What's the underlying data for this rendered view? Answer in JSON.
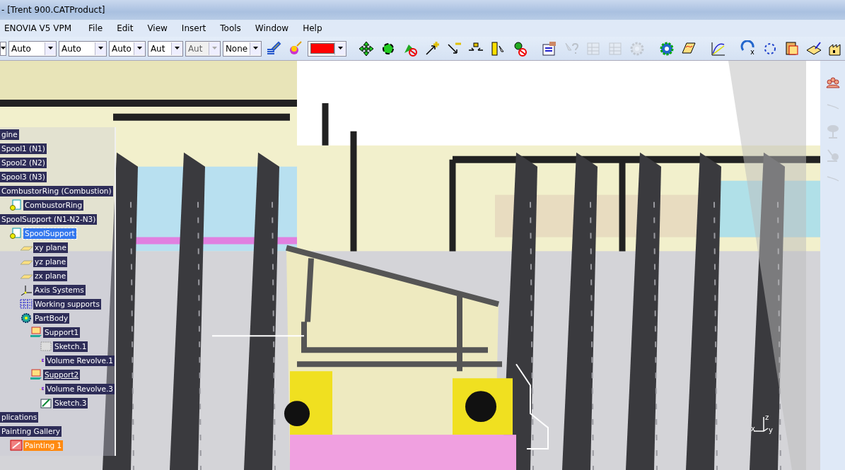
{
  "window": {
    "title": "- [Trent 900.CATProduct]"
  },
  "menu": [
    "ENOVIA V5 VPM",
    "File",
    "Edit",
    "View",
    "Insert",
    "Tools",
    "Window",
    "Help"
  ],
  "combos": [
    {
      "value": "Auto",
      "disabled": false
    },
    {
      "value": "Auto",
      "disabled": false
    },
    {
      "value": "Auto",
      "disabled": false
    },
    {
      "value": "Aut",
      "disabled": false
    },
    {
      "value": "Aut",
      "disabled": true
    },
    {
      "value": "None",
      "disabled": false
    }
  ],
  "color_combo": {
    "color": "#ff0000"
  },
  "tool_buttons": [
    {
      "kind": "brush",
      "disabled": false
    },
    {
      "kind": "ball",
      "disabled": false
    },
    {
      "kind": "move",
      "disabled": false
    },
    {
      "kind": "rotate",
      "disabled": false
    },
    {
      "kind": "nomove",
      "disabled": false
    },
    {
      "kind": "plus",
      "disabled": false
    },
    {
      "kind": "minus",
      "disabled": false
    },
    {
      "kind": "shrink",
      "disabled": false
    },
    {
      "kind": "ruler",
      "disabled": false
    },
    {
      "kind": "noanalyze",
      "disabled": false
    },
    {
      "kind": "form",
      "disabled": false
    },
    {
      "kind": "query",
      "disabled": true
    },
    {
      "kind": "table",
      "disabled": true
    },
    {
      "kind": "table",
      "disabled": true
    },
    {
      "kind": "gears",
      "disabled": true
    },
    {
      "kind": "gear",
      "disabled": false
    },
    {
      "kind": "sheet",
      "disabled": false
    },
    {
      "kind": "curve",
      "disabled": false
    },
    {
      "kind": "repeat",
      "disabled": false
    },
    {
      "kind": "circle",
      "disabled": false
    },
    {
      "kind": "clip",
      "disabled": false
    },
    {
      "kind": "book",
      "disabled": false
    },
    {
      "kind": "factory",
      "disabled": false
    }
  ],
  "side_buttons": [
    {
      "kind": "people",
      "disabled": false
    },
    {
      "kind": "line",
      "disabled": true
    },
    {
      "kind": "tree",
      "disabled": true
    },
    {
      "kind": "figure",
      "disabled": true
    },
    {
      "kind": "line",
      "disabled": true
    }
  ],
  "tree": [
    {
      "label": "gine",
      "selected": false,
      "highlighted": false,
      "underlined": false
    },
    {
      "label": "Spool1 (N1)",
      "selected": false,
      "highlighted": false,
      "underlined": false
    },
    {
      "label": "Spool2 (N2)",
      "selected": false,
      "highlighted": false,
      "underlined": false
    },
    {
      "label": "Spool3 (N3)",
      "selected": false,
      "highlighted": false,
      "underlined": false
    },
    {
      "label": "CombustorRing (Combustion)",
      "selected": false,
      "highlighted": false,
      "underlined": false,
      "children": [
        {
          "label": "CombustorRing",
          "kind": "part",
          "selected": false,
          "highlighted": false,
          "underlined": false
        }
      ]
    },
    {
      "label": "SpoolSupport (N1-N2-N3)",
      "selected": false,
      "highlighted": false,
      "underlined": false,
      "children": [
        {
          "label": "SpoolSupport",
          "kind": "part",
          "selected": true,
          "highlighted": false,
          "underlined": false,
          "children": [
            {
              "label": "xy plane",
              "kind": "plane",
              "selected": false,
              "highlighted": false,
              "underlined": false
            },
            {
              "label": "yz plane",
              "kind": "plane",
              "selected": false,
              "highlighted": false,
              "underlined": false
            },
            {
              "label": "zx plane",
              "kind": "plane",
              "selected": false,
              "highlighted": false,
              "underlined": false
            },
            {
              "label": "Axis Systems",
              "kind": "axis",
              "selected": false,
              "highlighted": false,
              "underlined": false
            },
            {
              "label": "Working supports",
              "kind": "grid",
              "selected": false,
              "highlighted": false,
              "underlined": false
            },
            {
              "label": "PartBody",
              "kind": "body",
              "selected": false,
              "highlighted": false,
              "underlined": false,
              "children": [
                {
                  "label": "Support1",
                  "kind": "support",
                  "selected": false,
                  "highlighted": false,
                  "underlined": false,
                  "children": [
                    {
                      "label": "Sketch.1",
                      "kind": "sketchgrey",
                      "selected": false,
                      "highlighted": false,
                      "underlined": false
                    },
                    {
                      "label": "Volume Revolve.1",
                      "kind": "revolve",
                      "selected": false,
                      "highlighted": false,
                      "underlined": false
                    }
                  ]
                },
                {
                  "label": "Support2",
                  "kind": "support",
                  "selected": false,
                  "highlighted": false,
                  "underlined": true,
                  "children": [
                    {
                      "label": "Volume Revolve.3",
                      "kind": "revolve",
                      "selected": false,
                      "highlighted": false,
                      "underlined": false
                    },
                    {
                      "label": "Sketch.3",
                      "kind": "sketch",
                      "selected": false,
                      "highlighted": false,
                      "underlined": false
                    }
                  ]
                }
              ]
            }
          ]
        }
      ]
    },
    {
      "label": "plications",
      "selected": false,
      "highlighted": false,
      "underlined": false
    },
    {
      "label": "Painting Gallery",
      "selected": false,
      "highlighted": false,
      "underlined": false,
      "children": [
        {
          "label": "Painting 1",
          "kind": "painting",
          "selected": false,
          "highlighted": true,
          "underlined": false
        }
      ]
    }
  ],
  "compass": {
    "labels": [
      "z",
      "x",
      "y"
    ]
  }
}
